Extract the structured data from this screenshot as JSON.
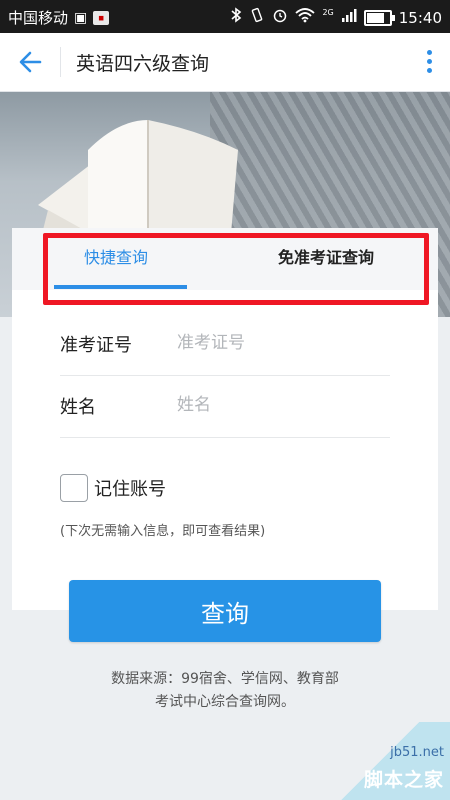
{
  "status_bar": {
    "carrier": "中国移动",
    "network": "2G",
    "time": "15:40",
    "icons": [
      "sim-icon",
      "app-badge-icon",
      "bluetooth-icon",
      "vibrate-icon",
      "alarm-icon",
      "wifi-icon",
      "signal-icon",
      "battery-icon"
    ]
  },
  "app_bar": {
    "title": "英语四六级查询",
    "back_icon": "arrow-left-icon",
    "more_icon": "more-vertical-icon",
    "accent_color": "#2d8ee6"
  },
  "tabs": [
    {
      "label": "快捷查询",
      "active": true
    },
    {
      "label": "免准考证查询",
      "active": false
    }
  ],
  "form": {
    "ticket_label": "准考证号",
    "ticket_placeholder": "准考证号",
    "ticket_value": "",
    "name_label": "姓名",
    "name_placeholder": "姓名",
    "name_value": "",
    "remember_label": "记住账号",
    "remember_checked": false,
    "hint": "(下次无需输入信息，即可查看结果)"
  },
  "query_button": "查询",
  "footer": {
    "line1": "数据来源：99宿舍、学信网、教育部",
    "line2": "考试中心综合查询网。"
  },
  "watermark": {
    "top": "jb51.net",
    "bottom": "脚本之家"
  },
  "highlight_color": "#ef1724"
}
